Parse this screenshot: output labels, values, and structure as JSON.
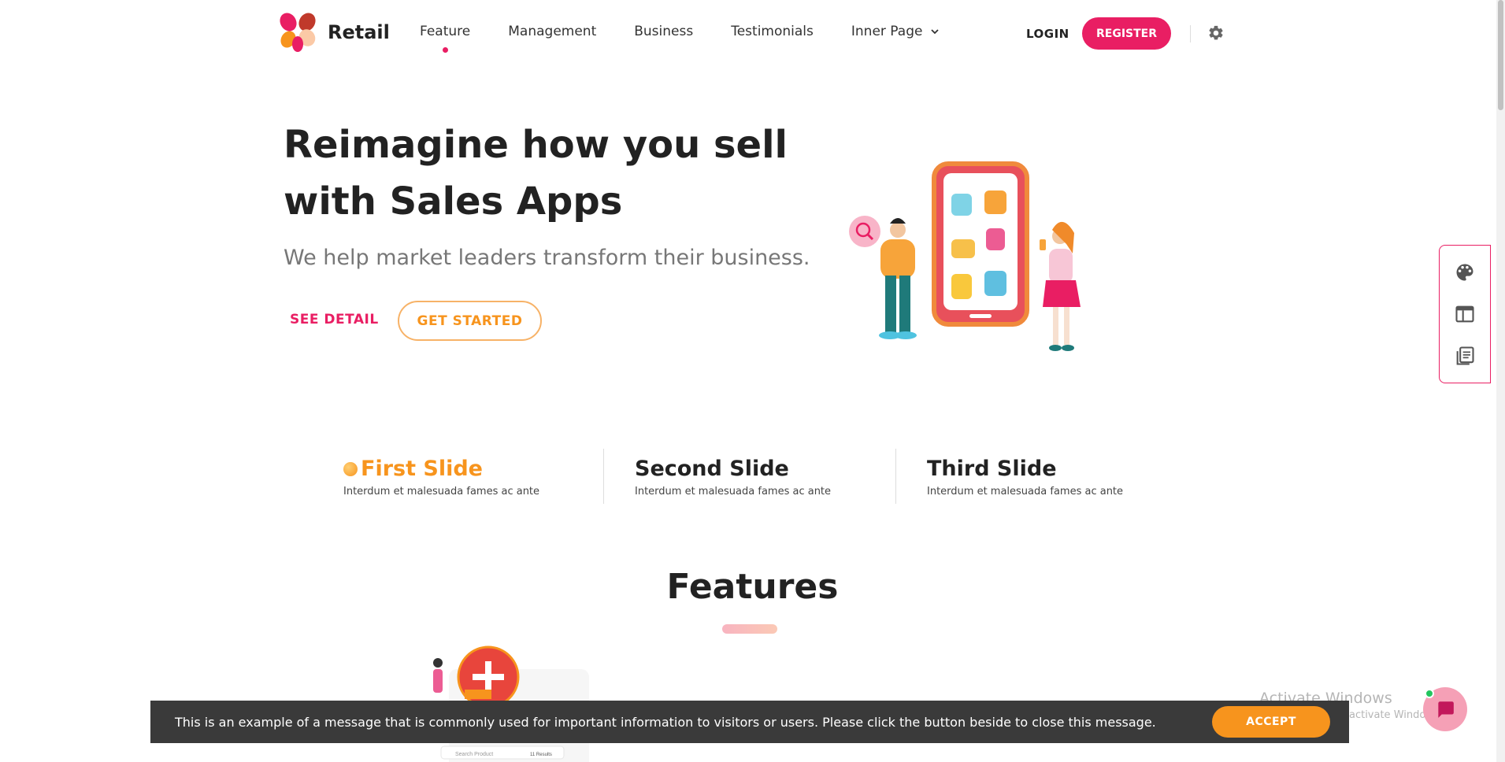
{
  "header": {
    "logo_text": "Retail",
    "nav": [
      {
        "label": "Feature",
        "active": true
      },
      {
        "label": "Management"
      },
      {
        "label": "Business"
      },
      {
        "label": "Testimonials"
      },
      {
        "label": "Inner Page",
        "has_dropdown": true
      }
    ],
    "login_label": "LOGIN",
    "register_label": "REGISTER",
    "settings_icon": "gear-icon"
  },
  "hero": {
    "title_line1": "Reimagine how you sell",
    "title_line2": "with Sales Apps",
    "subtitle": "We help market leaders transform their business.",
    "see_detail_label": "SEE DETAIL",
    "get_started_label": "GET STARTED"
  },
  "slides": [
    {
      "title": "First Slide",
      "desc": "Interdum et malesuada fames ac ante",
      "active": true
    },
    {
      "title": "Second Slide",
      "desc": "Interdum et malesuada fames ac ante"
    },
    {
      "title": "Third Slide",
      "desc": "Interdum et malesuada fames ac ante"
    }
  ],
  "features": {
    "title": "Features",
    "preview_search_text": "Search Product",
    "preview_results_text": "11 Results"
  },
  "side_panel": {
    "icons": [
      "palette-icon",
      "layout-icon",
      "pages-icon"
    ]
  },
  "cookie": {
    "message": "This is an example of a message that is commonly used for important information to visitors or users. Please click the button beside to close this message.",
    "accept_label": "ACCEPT"
  },
  "watermark": {
    "title": "Activate Windows",
    "subtitle": "Go to Settings to activate Windows."
  },
  "colors": {
    "primary": "#e91e63",
    "accent": "#f7941d",
    "dark_bar": "#3a3a3a"
  }
}
